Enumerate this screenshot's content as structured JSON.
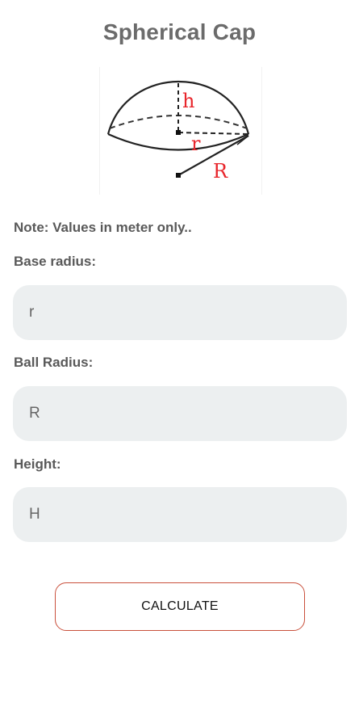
{
  "page": {
    "title": "Spherical Cap"
  },
  "diagram": {
    "label_h": "h",
    "label_r": "r",
    "label_R": "R"
  },
  "form": {
    "note": "Note: Values in meter only..",
    "base_radius_label": "Base radius:",
    "base_radius_placeholder": "r",
    "ball_radius_label": "Ball Radius:",
    "ball_radius_placeholder": "R",
    "height_label": "Height:",
    "height_placeholder": "H",
    "calculate_label": "CALCULATE"
  },
  "colors": {
    "title": "#6b6b6b",
    "input_background": "#eceff0",
    "button_border": "#c9503c",
    "diagram_label": "#e8262c"
  }
}
